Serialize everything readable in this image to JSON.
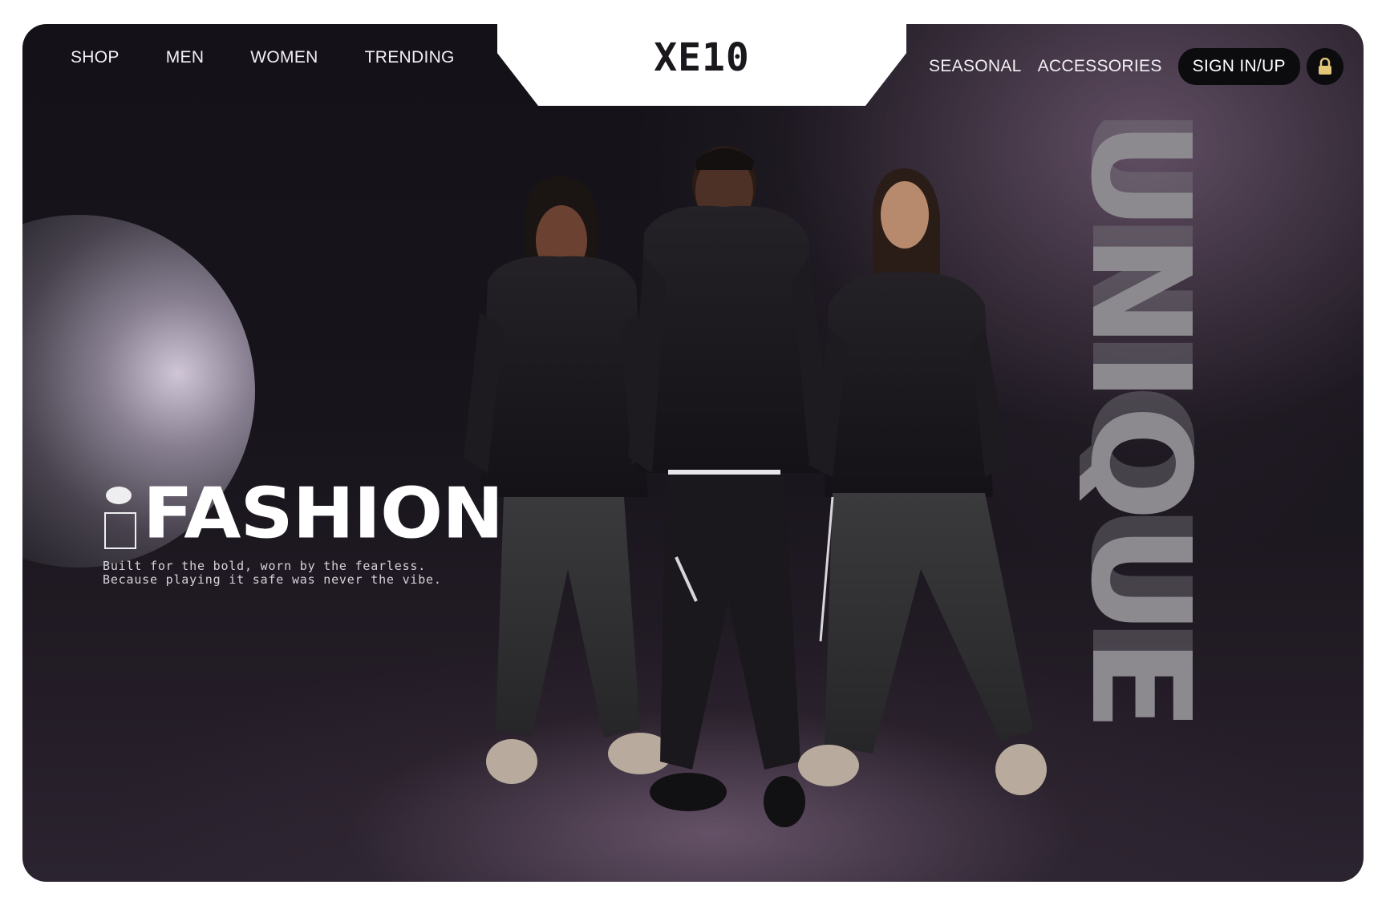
{
  "header": {
    "logo": "XE10",
    "nav_left": [
      "SHOP",
      "MEN",
      "WOMEN",
      "TRENDING"
    ],
    "nav_right": [
      "SEASONAL",
      "ACCESSORIES"
    ],
    "signin_label": "SIGN IN/UP",
    "lock_icon": "lock-icon"
  },
  "hero": {
    "headline": "FASHION",
    "tagline_line1": "Built for the bold, worn by the fearless.",
    "tagline_line2": "Because playing it safe was never the vibe.",
    "vertical_word": "UNIQUE"
  },
  "colors": {
    "background": "#17141b",
    "accent_glow": "#8f7a94",
    "text": "#ffffff",
    "button": "#0c0b0e"
  }
}
